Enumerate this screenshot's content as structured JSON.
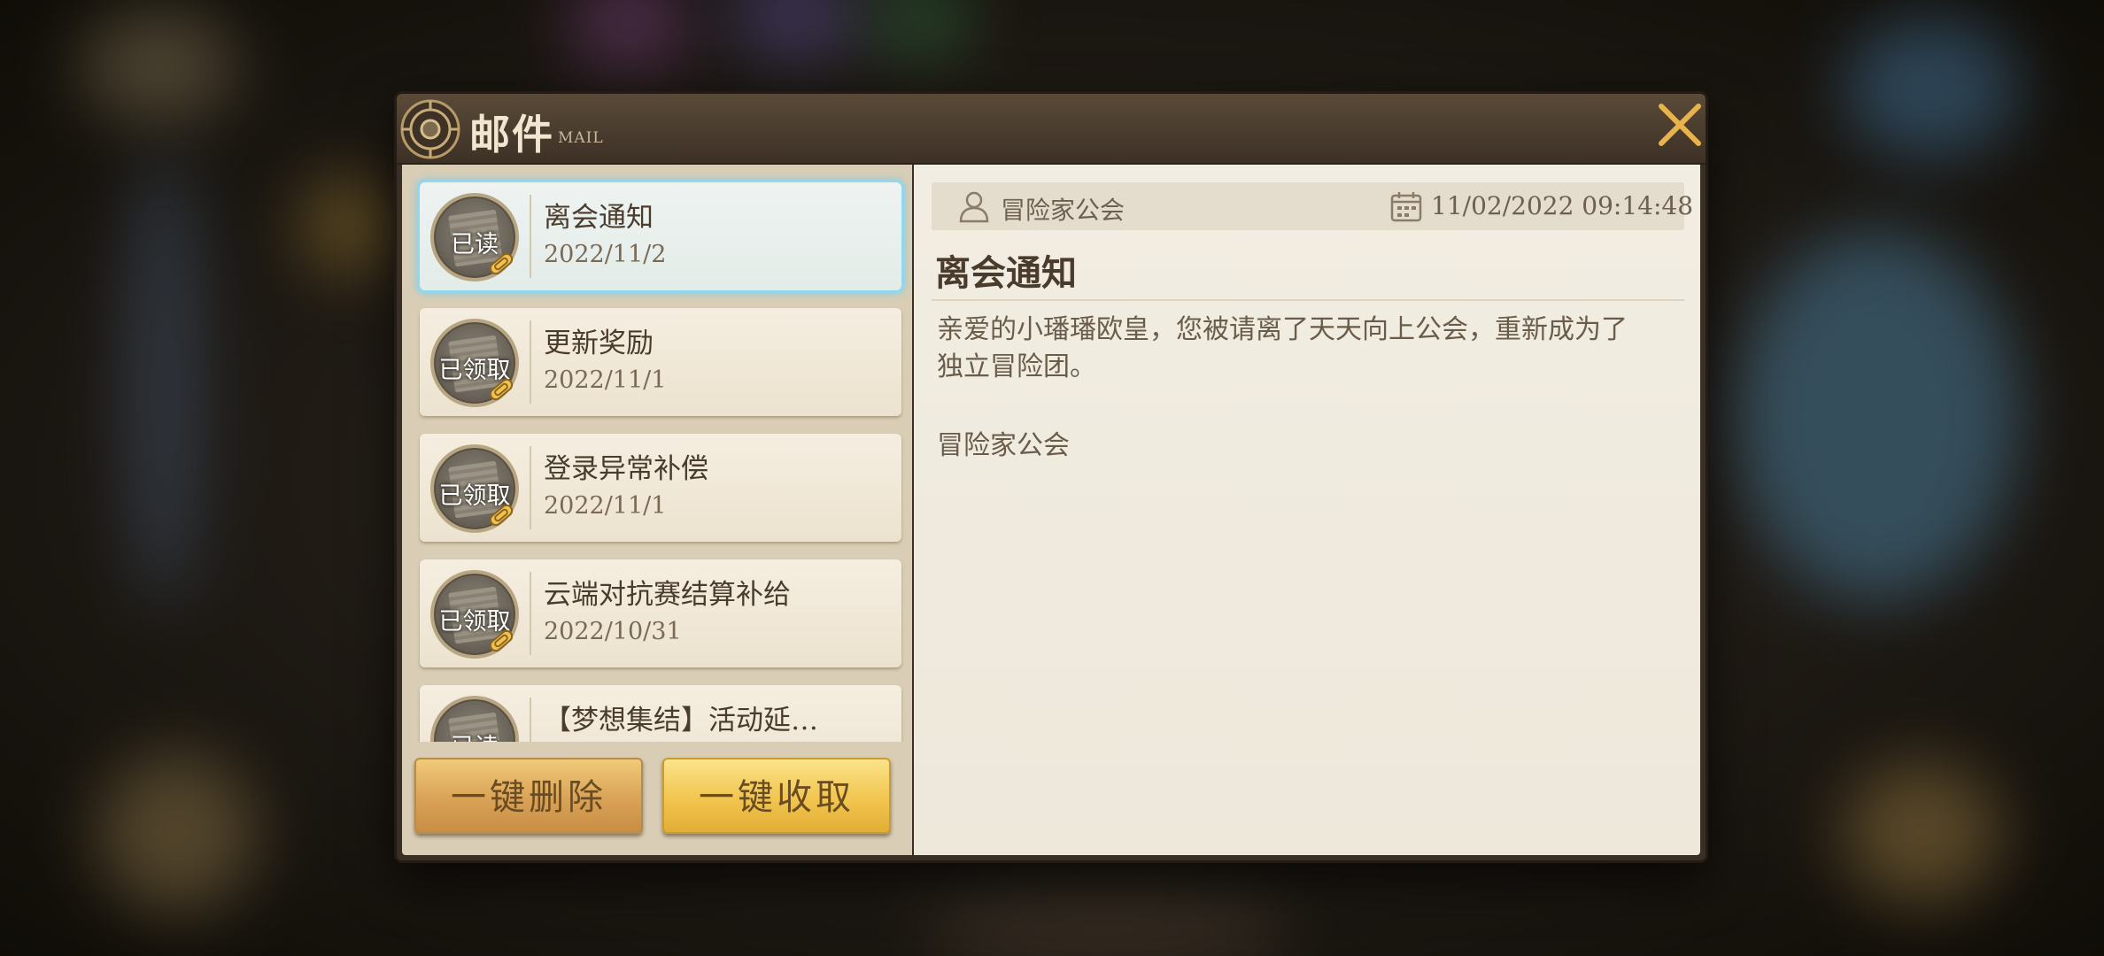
{
  "window": {
    "title": "邮件",
    "subtitle": "MAIL"
  },
  "mail_list": {
    "items": [
      {
        "title": "离会通知",
        "date": "2022/11/2",
        "status": "已读",
        "selected": true
      },
      {
        "title": "更新奖励",
        "date": "2022/11/1",
        "status": "已领取",
        "selected": false
      },
      {
        "title": "登录异常补偿",
        "date": "2022/11/1",
        "status": "已领取",
        "selected": false
      },
      {
        "title": "云端对抗赛结算补给",
        "date": "2022/10/31",
        "status": "已领取",
        "selected": false
      },
      {
        "title": "【梦想集结】活动延…",
        "date": "",
        "status": "已读",
        "selected": false
      }
    ]
  },
  "actions": {
    "delete_all": "一键删除",
    "collect_all": "一键收取"
  },
  "detail": {
    "sender": "冒险家公会",
    "datetime": "11/02/2022 09:14:48",
    "title": "离会通知",
    "body": "亲爱的小璠璠欧皇，您被请离了天天向上公会，重新成为了\n独立冒险团。",
    "signature": "冒险家公会"
  },
  "icons": {
    "emblem": "guild-emblem-icon",
    "close": "close-icon",
    "sender": "user-icon",
    "date": "calendar-icon",
    "attachment": "paperclip-icon"
  },
  "colors": {
    "selection_glow": "#8fd8f0",
    "accent_gold": "#e8b34a",
    "text_dark": "#4a3c2c"
  }
}
